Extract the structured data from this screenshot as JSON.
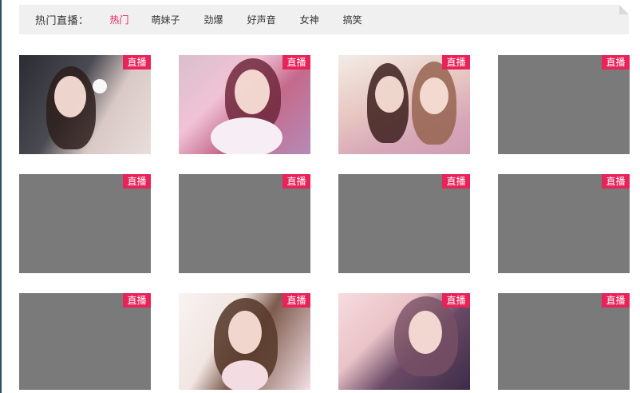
{
  "tabs": {
    "heading": "热门直播：",
    "items": [
      {
        "label": "热门",
        "active": true
      },
      {
        "label": "萌妹子",
        "active": false
      },
      {
        "label": "劲爆",
        "active": false
      },
      {
        "label": "好声音",
        "active": false
      },
      {
        "label": "女神",
        "active": false
      },
      {
        "label": "搞笑",
        "active": false
      }
    ]
  },
  "streams": [
    {
      "badge": "直播",
      "thumbnail": "photo"
    },
    {
      "badge": "直播",
      "thumbnail": "photo"
    },
    {
      "badge": "直播",
      "thumbnail": "photo"
    },
    {
      "badge": "直播",
      "thumbnail": "empty"
    },
    {
      "badge": "直播",
      "thumbnail": "empty"
    },
    {
      "badge": "直播",
      "thumbnail": "empty"
    },
    {
      "badge": "直播",
      "thumbnail": "empty"
    },
    {
      "badge": "直播",
      "thumbnail": "empty"
    },
    {
      "badge": "直播",
      "thumbnail": "empty"
    },
    {
      "badge": "直播",
      "thumbnail": "photo"
    },
    {
      "badge": "直播",
      "thumbnail": "photo"
    },
    {
      "badge": "直播",
      "thumbnail": "empty"
    }
  ],
  "colors": {
    "accent": "#e8235a",
    "placeholder": "#7a7a7a",
    "tabbar_bg": "#f0f0f0"
  }
}
